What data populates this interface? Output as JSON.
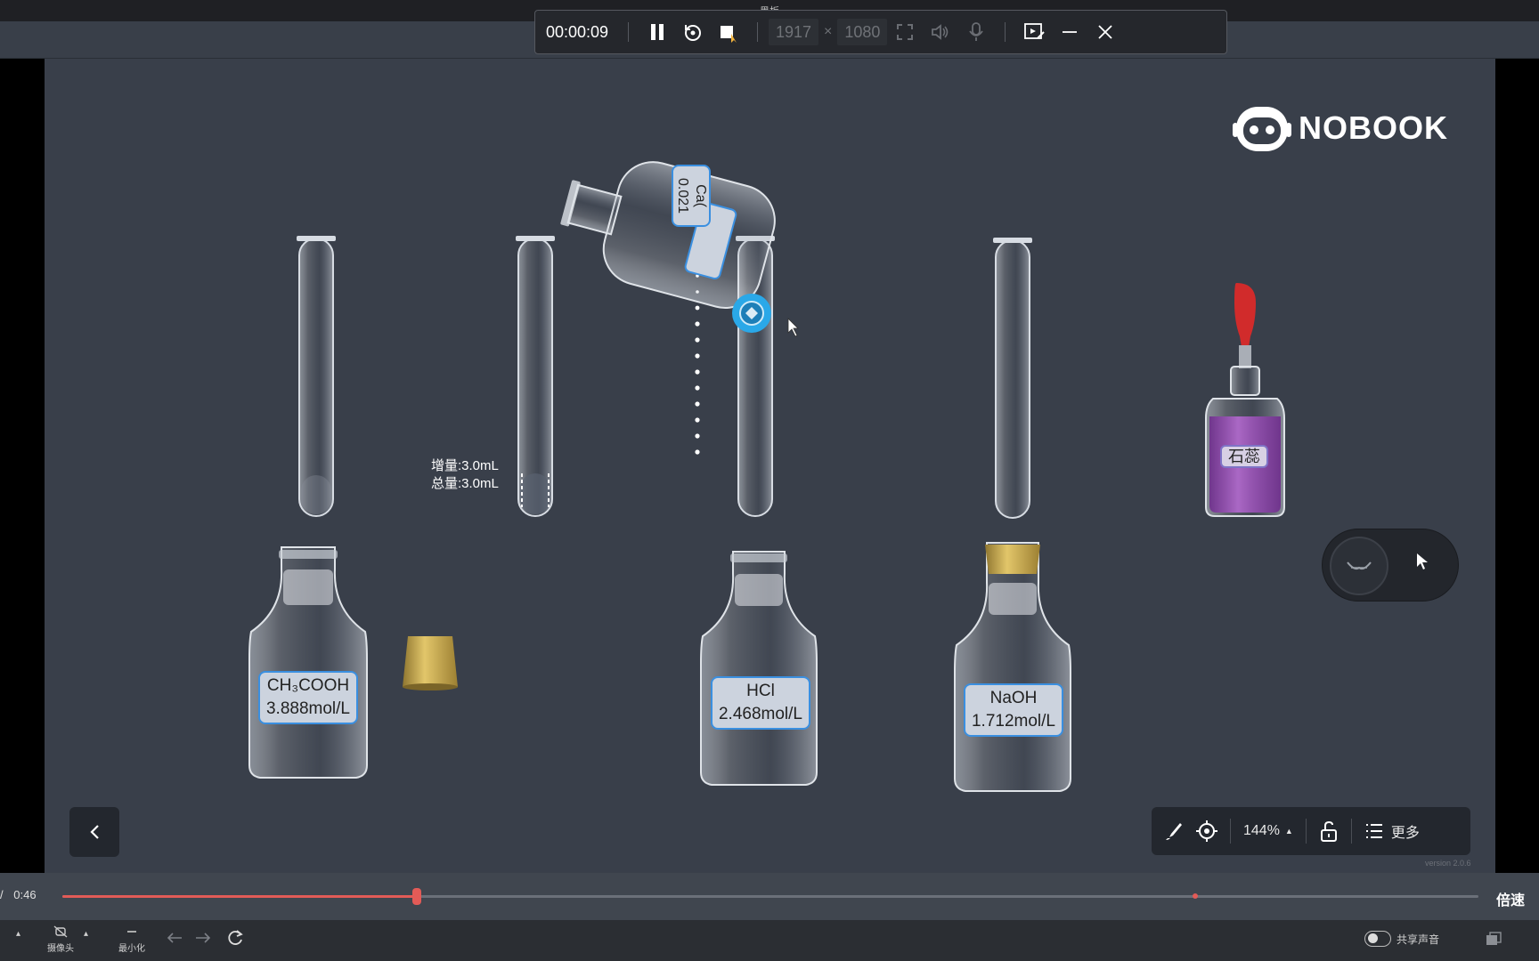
{
  "window": {
    "title": "黑板"
  },
  "recorder": {
    "elapsed": "00:00:09",
    "width": "1917",
    "height": "1080",
    "times_sign": "×"
  },
  "brand": {
    "name": "NOBOOK"
  },
  "experiment": {
    "tube_readout": {
      "increment": "增量:3.0mL",
      "total": "总量:3.0mL"
    },
    "tilted_bottle": {
      "formula": "Ca(",
      "concentration": "0.021"
    },
    "reagents": [
      {
        "formula": "CH₃COOH",
        "concentration": "3.888mol/L"
      },
      {
        "formula": "HCl",
        "concentration": "2.468mol/L"
      },
      {
        "formula": "NaOH",
        "concentration": "1.712mol/L"
      }
    ],
    "litmus": {
      "label": "石蕊"
    }
  },
  "toolbar": {
    "zoom": "144%",
    "more_label": "更多",
    "version": "version 2.0.6"
  },
  "player": {
    "current_time": "/",
    "duration": "0:46",
    "progress_fraction": 0.25,
    "marker_fraction": 0.8,
    "speed_label": "倍速"
  },
  "bottom_bar": {
    "camera_label": "摄像头",
    "minimize_label": "最小化",
    "share_audio_label": "共享声音"
  },
  "colors": {
    "canvas": "#393f4a",
    "accent_blue": "#2aa8e8",
    "progress": "#e25b57",
    "litmus_purple": "#8a3fa8",
    "dropper_red": "#d12b2b",
    "cap_gold": "#c9a642"
  }
}
